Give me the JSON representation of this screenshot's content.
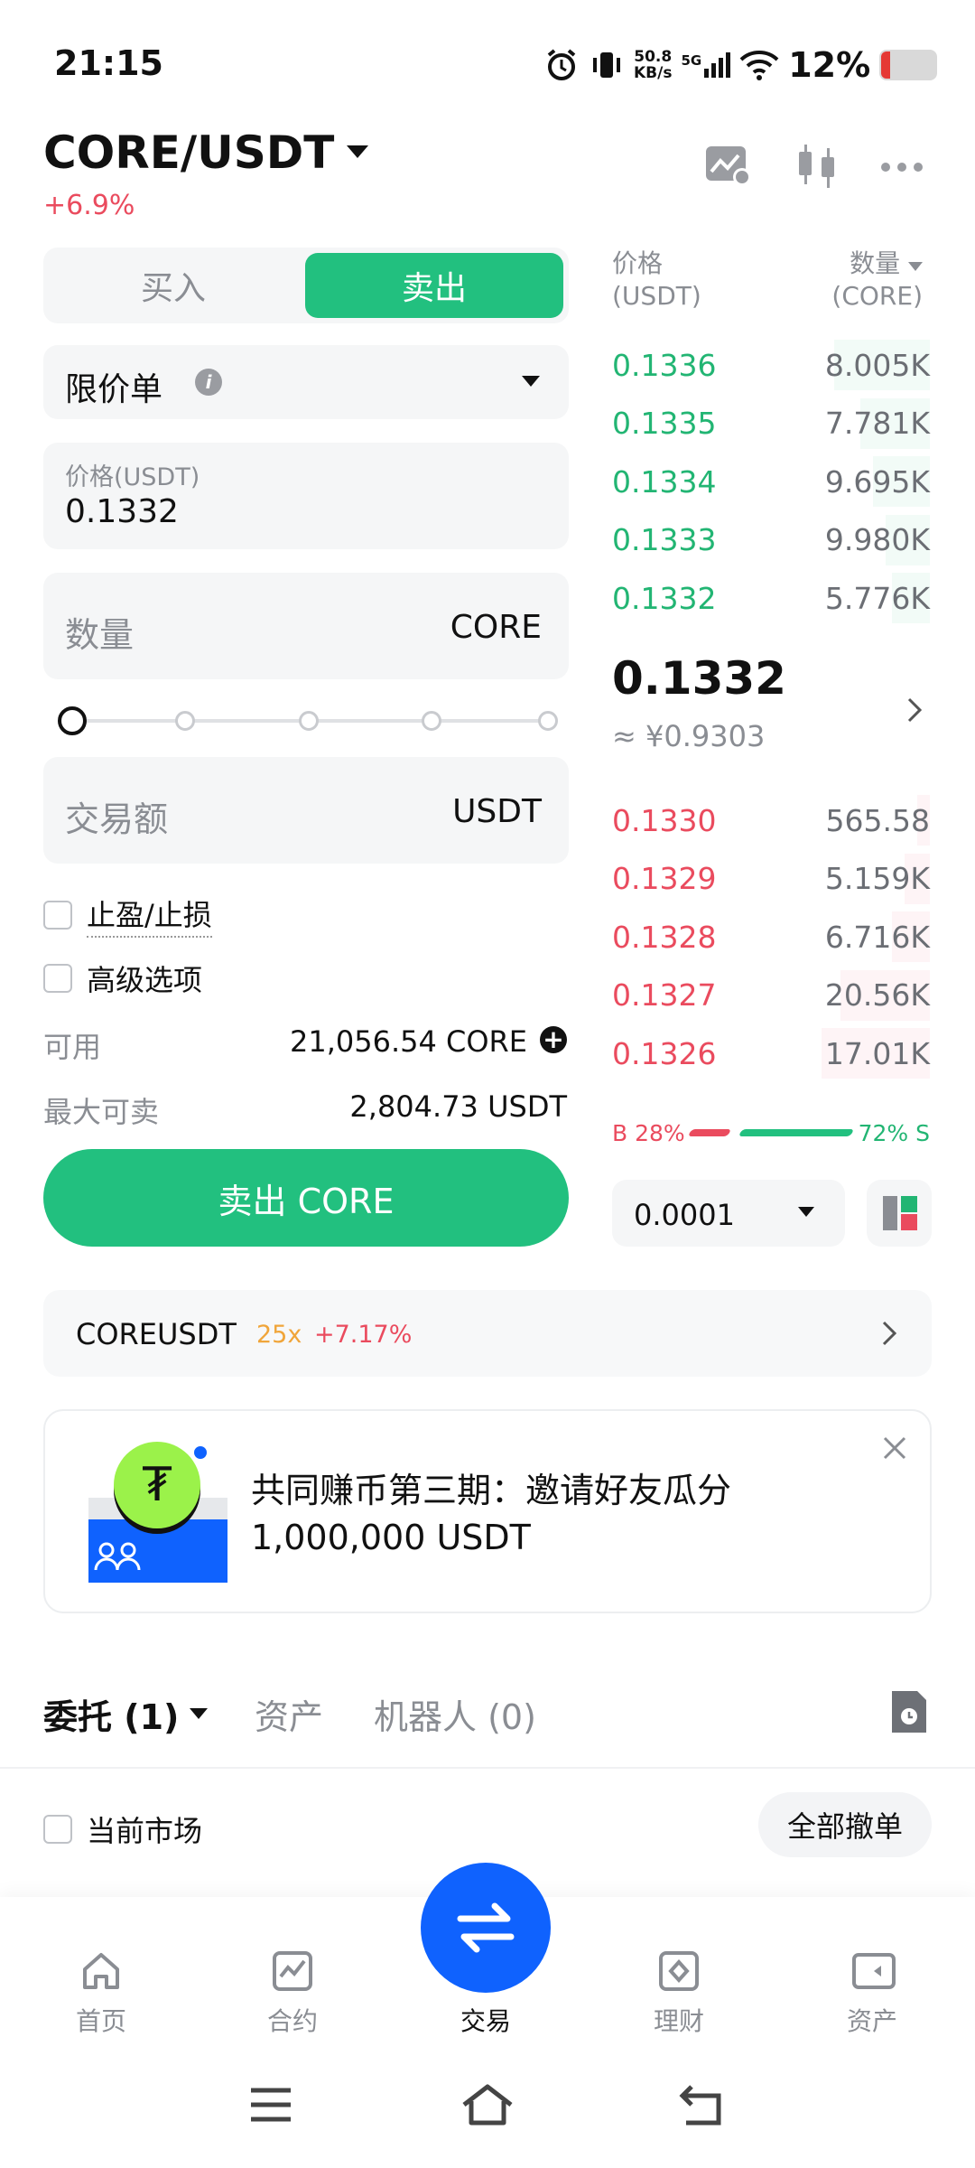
{
  "status_bar": {
    "time": "21:15",
    "net_speed_top": "50.8",
    "net_speed_bottom": "KB/s",
    "network": "5G",
    "battery": "12%"
  },
  "header": {
    "pair": "CORE/USDT",
    "change": "+6.9%"
  },
  "trade_tabs": {
    "buy": "买入",
    "sell": "卖出"
  },
  "order_type": {
    "label": "限价单"
  },
  "price_field": {
    "label": "价格(USDT)",
    "value": "0.1332"
  },
  "amount_field": {
    "placeholder": "数量",
    "unit": "CORE"
  },
  "slider": {
    "fraction": 0
  },
  "total_field": {
    "placeholder": "交易额",
    "unit": "USDT"
  },
  "options": {
    "tp_sl": "止盈/止损",
    "advanced": "高级选项"
  },
  "available": {
    "label": "可用",
    "value": "21,056.54 CORE"
  },
  "max_sell": {
    "label": "最大可卖",
    "value": "2,804.73 USDT"
  },
  "submit": {
    "label": "卖出 CORE"
  },
  "orderbook": {
    "price_header": "价格",
    "price_unit": "(USDT)",
    "qty_header": "数量",
    "qty_unit": "(CORE)",
    "asks": [
      {
        "price": "0.1336",
        "qty": "8.005K",
        "depth": 0.3
      },
      {
        "price": "0.1335",
        "qty": "7.781K",
        "depth": 0.22
      },
      {
        "price": "0.1334",
        "qty": "9.695K",
        "depth": 0.18
      },
      {
        "price": "0.1333",
        "qty": "9.980K",
        "depth": 0.14
      },
      {
        "price": "0.1332",
        "qty": "5.776K",
        "depth": 0.12
      }
    ],
    "last_price": "0.1332",
    "last_price_cny": "≈ ¥0.9303",
    "bids": [
      {
        "price": "0.1330",
        "qty": "565.58",
        "depth": 0.04
      },
      {
        "price": "0.1329",
        "qty": "5.159K",
        "depth": 0.08
      },
      {
        "price": "0.1328",
        "qty": "6.716K",
        "depth": 0.12
      },
      {
        "price": "0.1327",
        "qty": "20.56K",
        "depth": 0.28
      },
      {
        "price": "0.1326",
        "qty": "17.01K",
        "depth": 0.34
      }
    ],
    "buy_ratio": "B 28%",
    "sell_ratio": "72% S",
    "buy_fraction": 0.28,
    "precision": "0.0001"
  },
  "futures_link": {
    "symbol": "COREUSDT",
    "leverage": "25x",
    "change": "+7.17%"
  },
  "promo": {
    "line1": "共同赚币第三期：邀请好友瓜分",
    "line2": "1,000,000 USDT"
  },
  "bottom_tabs": {
    "orders": "委托 (1)",
    "assets": "资产",
    "bots": "机器人 (0)"
  },
  "orders_filter": {
    "current_market": "当前市场",
    "cancel_all": "全部撤单"
  },
  "nav": {
    "home": "首页",
    "futures": "合约",
    "trade": "交易",
    "earn": "理财",
    "assets": "资产"
  },
  "colors": {
    "green": "#22b573",
    "red": "#ea4b5e",
    "brand_blue": "#0f62fe"
  }
}
